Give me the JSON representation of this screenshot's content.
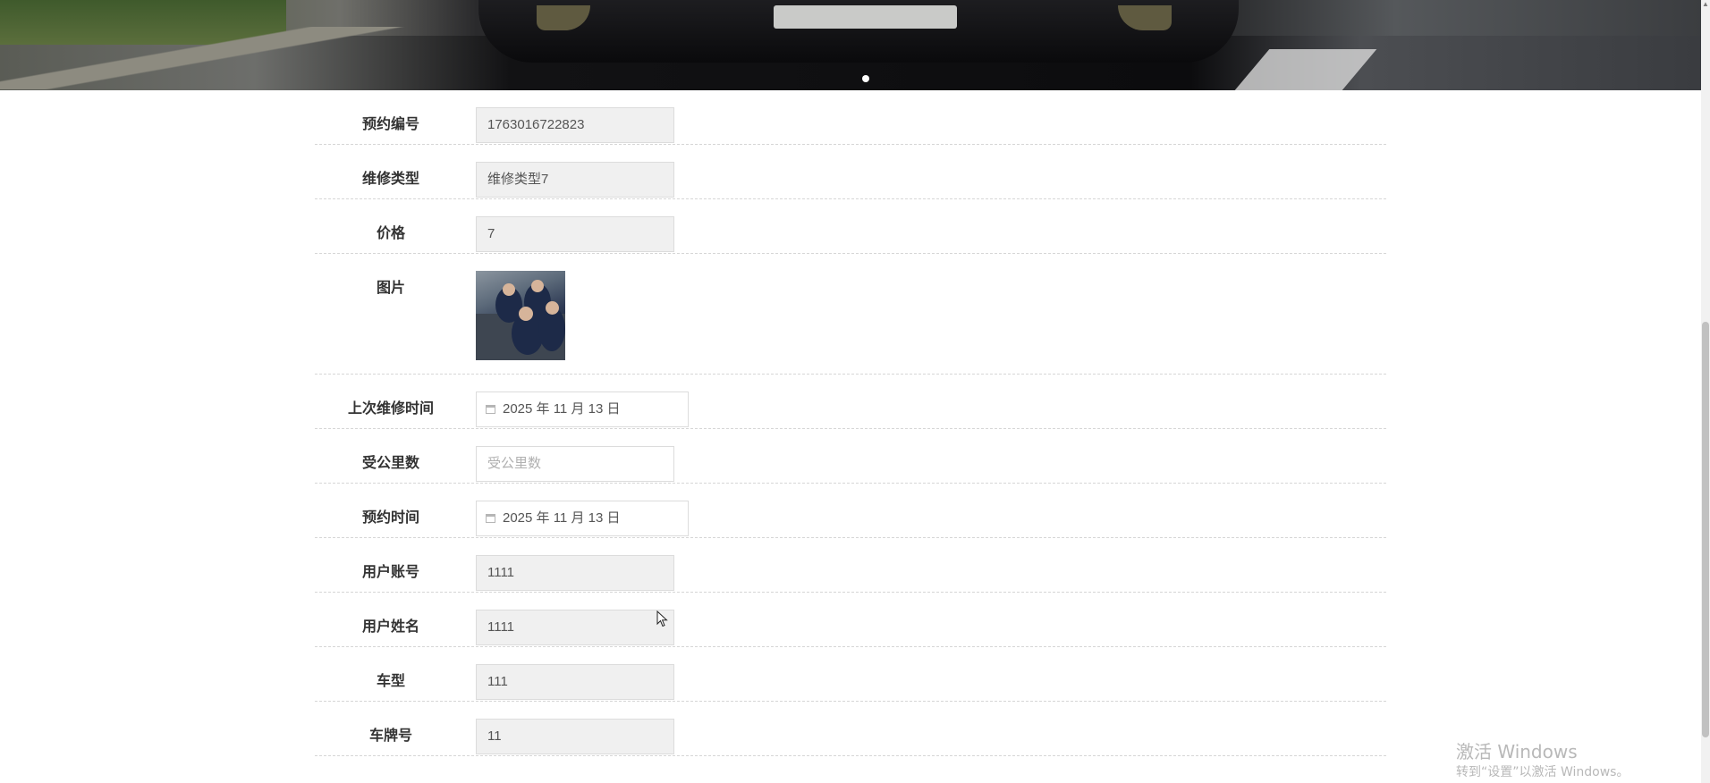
{
  "banner": {
    "active_slide_dot": "carousel-dot"
  },
  "form": {
    "fields": [
      {
        "label": "预约编号",
        "value": "1763016722823",
        "type": "text"
      },
      {
        "label": "维修类型",
        "value": "维修类型7",
        "type": "text"
      },
      {
        "label": "价格",
        "value": "7",
        "type": "text"
      },
      {
        "label": "图片",
        "value": "",
        "type": "image"
      },
      {
        "label": "上次维修时间",
        "value": "2025 年 11 月 13 日",
        "type": "date"
      },
      {
        "label": "受公里数",
        "placeholder": "受公里数",
        "type": "input"
      },
      {
        "label": "预约时间",
        "value": "2025 年 11 月 13 日",
        "type": "date"
      },
      {
        "label": "用户账号",
        "value": "1111",
        "type": "text"
      },
      {
        "label": "用户姓名",
        "value": "1111",
        "type": "text"
      },
      {
        "label": "车型",
        "value": "111",
        "type": "text"
      },
      {
        "label": "车牌号",
        "value": "11",
        "type": "text"
      }
    ]
  },
  "watermark": {
    "line1": "激活 Windows",
    "line2": "转到“设置”以激活 Windows。"
  },
  "scrollbar": {
    "up_arrow": "▲"
  }
}
